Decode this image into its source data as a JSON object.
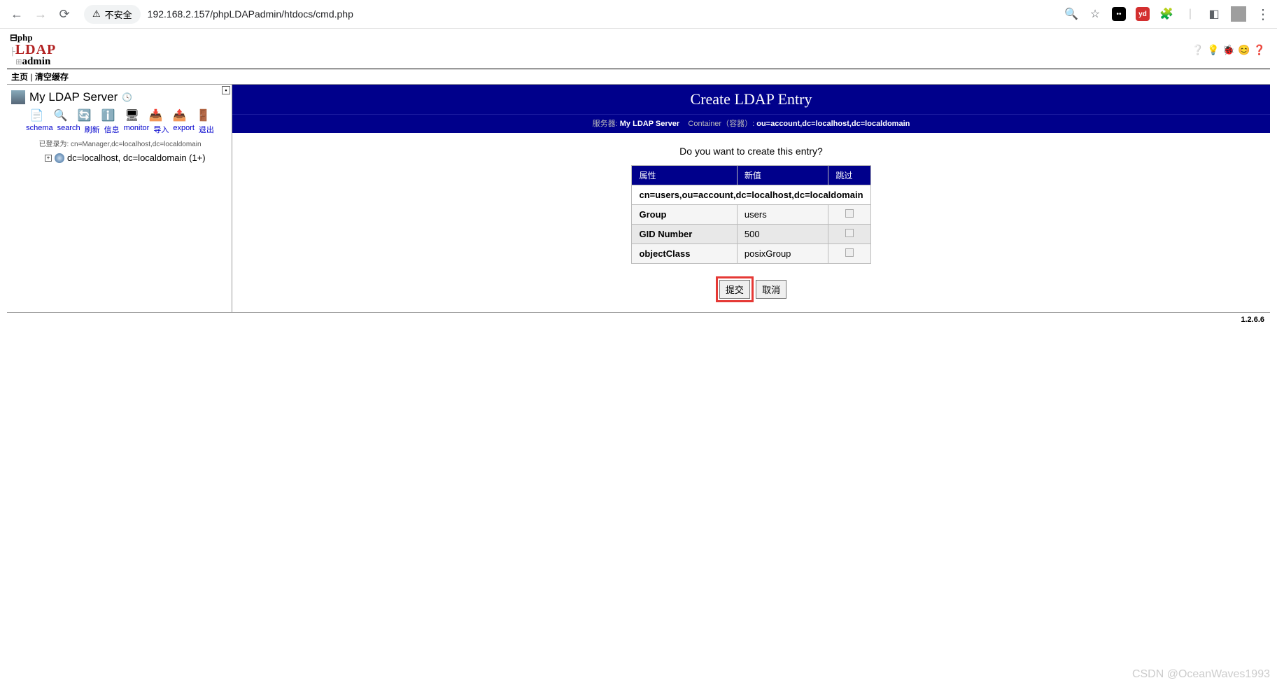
{
  "browser": {
    "security_label": "不安全",
    "url": "192.168.2.157/phpLDAPadmin/htdocs/cmd.php"
  },
  "logo": {
    "l1": "php",
    "l2": "LDAP",
    "l3": "admin"
  },
  "topnav": {
    "home": "主页",
    "purge": "清空缓存",
    "sep": " | "
  },
  "sidebar": {
    "server_name": "My LDAP Server",
    "actions": {
      "schema": "schema",
      "search": "search",
      "refresh": "刷新",
      "info": "信息",
      "monitor": "monitor",
      "import": "导入",
      "export": "export",
      "logout": "退出"
    },
    "logged_in_prefix": "已登录为: ",
    "logged_in_dn": "cn=Manager,dc=localhost,dc=localdomain",
    "tree_node": "dc=localhost, dc=localdomain (1+)"
  },
  "content": {
    "title": "Create LDAP Entry",
    "server_label": "服务器:",
    "server_value": "My LDAP Server",
    "container_label": "Container（容器）:",
    "container_value": "ou=account,dc=localhost,dc=localdomain",
    "prompt": "Do you want to create this entry?",
    "headers": {
      "attr": "属性",
      "newval": "新值",
      "skip": "跳过"
    },
    "dn": "cn=users,ou=account,dc=localhost,dc=localdomain",
    "rows": [
      {
        "attr": "Group",
        "val": "users"
      },
      {
        "attr": "GID Number",
        "val": "500"
      },
      {
        "attr": "objectClass",
        "val": "posixGroup"
      }
    ],
    "submit": "提交",
    "cancel": "取消"
  },
  "version": "1.2.6.6",
  "watermark": "CSDN @OceanWaves1993"
}
